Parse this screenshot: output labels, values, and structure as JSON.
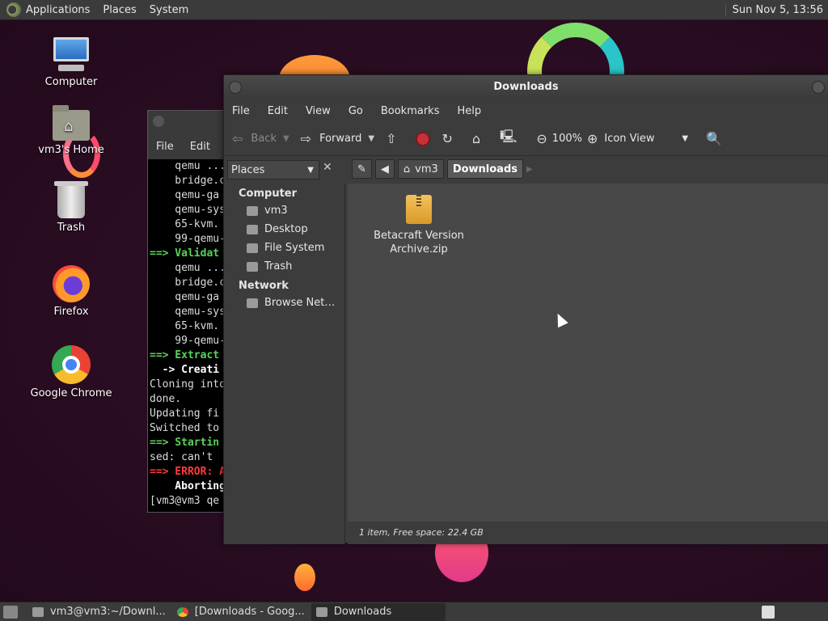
{
  "top_panel": {
    "menus": [
      "Applications",
      "Places",
      "System"
    ],
    "clock": "Sun Nov  5, 13:56"
  },
  "desktop_icons": [
    {
      "label": "Computer",
      "icon": "computer-icon"
    },
    {
      "label": "vm3's Home",
      "icon": "home-folder-icon"
    },
    {
      "label": "Trash",
      "icon": "trash-icon"
    },
    {
      "label": "Firefox",
      "icon": "firefox-icon"
    },
    {
      "label": "Google Chrome",
      "icon": "chrome-icon"
    }
  ],
  "terminal": {
    "menus": [
      "File",
      "Edit"
    ],
    "lines": [
      {
        "text": "    qemu ...",
        "style": ""
      },
      {
        "text": "    bridge.c",
        "style": ""
      },
      {
        "text": "    qemu-ga",
        "style": ""
      },
      {
        "text": "    qemu-sys",
        "style": ""
      },
      {
        "text": "    65-kvm.",
        "style": ""
      },
      {
        "text": "    99-qemu-",
        "style": ""
      },
      {
        "text": "==> Validat",
        "style": "green"
      },
      {
        "text": "    qemu ...",
        "style": ""
      },
      {
        "text": "    bridge.c",
        "style": ""
      },
      {
        "text": "    qemu-ga",
        "style": ""
      },
      {
        "text": "    qemu-sys",
        "style": ""
      },
      {
        "text": "    65-kvm.",
        "style": ""
      },
      {
        "text": "    99-qemu-",
        "style": ""
      },
      {
        "text": "==> Extract",
        "style": "green"
      },
      {
        "text": "  -> Creati",
        "style": "bold"
      },
      {
        "text": "Cloning into",
        "style": ""
      },
      {
        "text": "done.",
        "style": ""
      },
      {
        "text": "Updating fi",
        "style": ""
      },
      {
        "text": "Switched to",
        "style": ""
      },
      {
        "text": "==> Startin",
        "style": "green"
      },
      {
        "text": "sed: can't",
        "style": ""
      },
      {
        "text": "==> ERROR: A",
        "style": "red"
      },
      {
        "text": "    Aborting",
        "style": "bold"
      },
      {
        "text": "[vm3@vm3 qe",
        "style": ""
      }
    ]
  },
  "file_manager": {
    "title": "Downloads",
    "menus": [
      "File",
      "Edit",
      "View",
      "Go",
      "Bookmarks",
      "Help"
    ],
    "toolbar": {
      "back": "Back",
      "forward": "Forward",
      "zoom": "100%",
      "view_mode": "Icon View"
    },
    "places_label": "Places",
    "path": [
      "vm3",
      "Downloads"
    ],
    "sidebar": {
      "sections": [
        {
          "title": "Computer",
          "items": [
            "vm3",
            "Desktop",
            "File System",
            "Trash"
          ]
        },
        {
          "title": "Network",
          "items": [
            "Browse Net…"
          ]
        }
      ]
    },
    "files": [
      {
        "name": "Betacraft Version Archive.zip",
        "icon": "zip-archive-icon"
      }
    ],
    "status": "1 item, Free space: 22.4 GB"
  },
  "taskbar": {
    "tasks": [
      {
        "label": "vm3@vm3:~/Downl...",
        "icon": "terminal-icon",
        "active": false
      },
      {
        "label": "[Downloads - Goog...",
        "icon": "chrome-icon",
        "active": false
      },
      {
        "label": "Downloads",
        "icon": "folder-icon",
        "active": true
      }
    ]
  },
  "colors": {
    "panel": "#3b3b3b",
    "window_bg": "#3c3c3c",
    "content_bg": "#484848",
    "terminal_green": "#5ad35a",
    "terminal_red": "#ff3b3b"
  }
}
